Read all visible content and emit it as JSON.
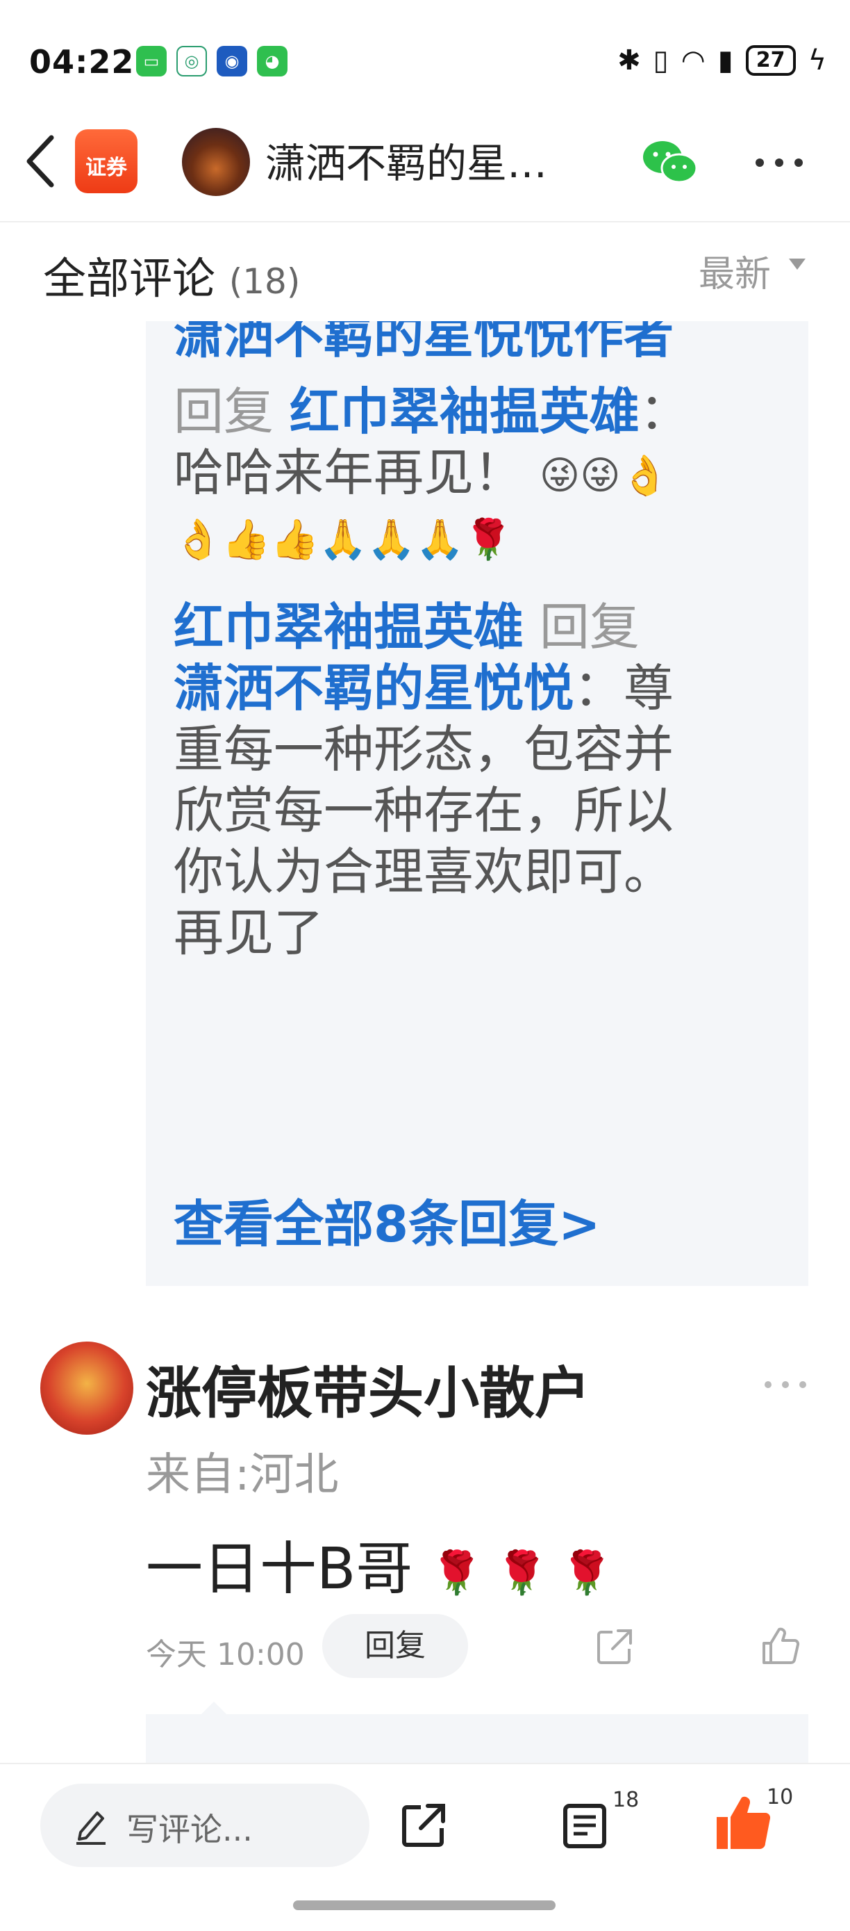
{
  "status_bar": {
    "time": "04:22",
    "battery": "27"
  },
  "nav": {
    "badge": "证券",
    "title": "潇洒不羁的星…"
  },
  "comments_header": {
    "title": "全部评论",
    "count": "(18)",
    "sort": "最新"
  },
  "reply_panel": {
    "partial_top": "潇洒不羁的星悦悦作者",
    "reply1": {
      "reply_word": "回复",
      "target": "红巾翠袖揾英雄",
      "colon": "：",
      "text": "哈哈来年再见！",
      "emojis_line1": "😜😜👌",
      "emojis_line2": "👌👍👍🙏🙏🙏🌹"
    },
    "reply2": {
      "author": "红巾翠袖揾英雄",
      "reply_word": "回复",
      "target": "潇洒不羁的星悦悦",
      "colon": "：",
      "line1": "尊",
      "line2": "重每一种形态，包容并",
      "line3": "欣赏每一种存在，所以",
      "line4": "你认为合理喜欢即可。",
      "line5": "再见了"
    },
    "view_all": "查看全部8条回复>"
  },
  "comment2": {
    "author": "涨停板带头小散户",
    "location": "来自:河北",
    "body": "一日十B哥",
    "emojis": "🌹 🌹 🌹",
    "time": "今天 10:00",
    "reply_button": "回复"
  },
  "bottom_bar": {
    "compose_placeholder": "写评论...",
    "comment_count": "18",
    "like_count": "10"
  },
  "colors": {
    "accent_blue": "#1f6fcf",
    "accent_orange": "#ff5a1f",
    "panel_bg": "#f4f6f9"
  }
}
